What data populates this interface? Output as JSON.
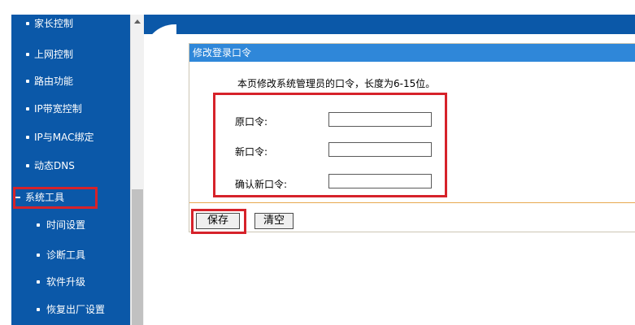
{
  "sidebar": {
    "items": [
      {
        "label": "家长控制",
        "marker": "bullet"
      },
      {
        "label": "上网控制",
        "marker": "bullet"
      },
      {
        "label": "路由功能",
        "marker": "bullet"
      },
      {
        "label": "IP带宽控制",
        "marker": "bullet"
      },
      {
        "label": "IP与MAC绑定",
        "marker": "bullet"
      },
      {
        "label": "动态DNS",
        "marker": "bullet"
      },
      {
        "label": "系统工具",
        "marker": "dash",
        "highlighted": true
      },
      {
        "label": "时间设置",
        "marker": "bullet",
        "sub": true
      },
      {
        "label": "诊断工具",
        "marker": "bullet",
        "sub": true
      },
      {
        "label": "软件升级",
        "marker": "bullet",
        "sub": true
      },
      {
        "label": "恢复出厂设置",
        "marker": "bullet",
        "sub": true
      }
    ]
  },
  "panel": {
    "title": "修改登录口令",
    "description": "本页修改系统管理员的口令，长度为6-15位。",
    "fields": {
      "old_password": {
        "label": "原口令:",
        "value": ""
      },
      "new_password": {
        "label": "新口令:",
        "value": ""
      },
      "confirm_password": {
        "label": "确认新口令:",
        "value": ""
      }
    },
    "buttons": {
      "save": "保存",
      "clear": "清空"
    }
  },
  "colors": {
    "sidebar_bg": "#0b58a8",
    "panel_header_bg": "#2f87d9",
    "highlight_border": "#d6222a",
    "divider": "#e8a94f"
  }
}
